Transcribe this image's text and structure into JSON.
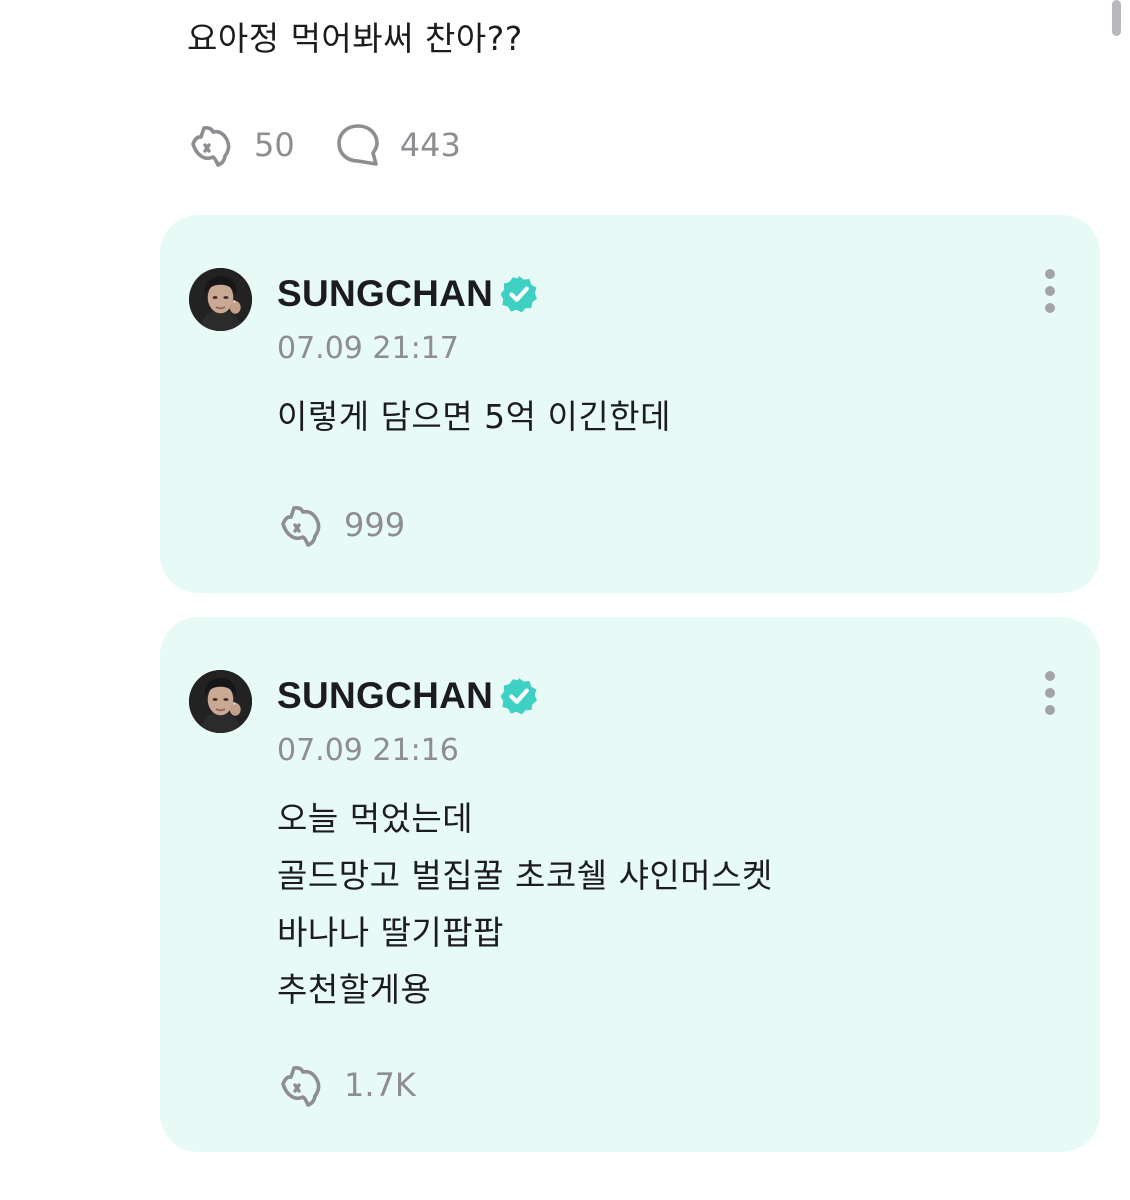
{
  "post": {
    "text": "요아정 먹어봐써 찬아??",
    "like_count": "50",
    "comment_count": "443",
    "like_icon": "star-hand-icon",
    "comment_icon": "speech-bubble-icon"
  },
  "replies": [
    {
      "author": "SUNGCHAN",
      "verified": true,
      "timestamp": "07.09 21:17",
      "body": "이렇게 담으면 5억 이긴한데",
      "like_count": "999"
    },
    {
      "author": "SUNGCHAN",
      "verified": true,
      "timestamp": "07.09 21:16",
      "body": "오늘 먹었는데\n골드망고 벌집꿀 초코쉘 샤인머스켓\n바나나 딸기팝팝\n추천할게용",
      "like_count": "1.7K"
    }
  ],
  "colors": {
    "card_background": "#e8faf5",
    "verified_badge": "#3fd0c4",
    "muted_text": "#8d8d92"
  }
}
